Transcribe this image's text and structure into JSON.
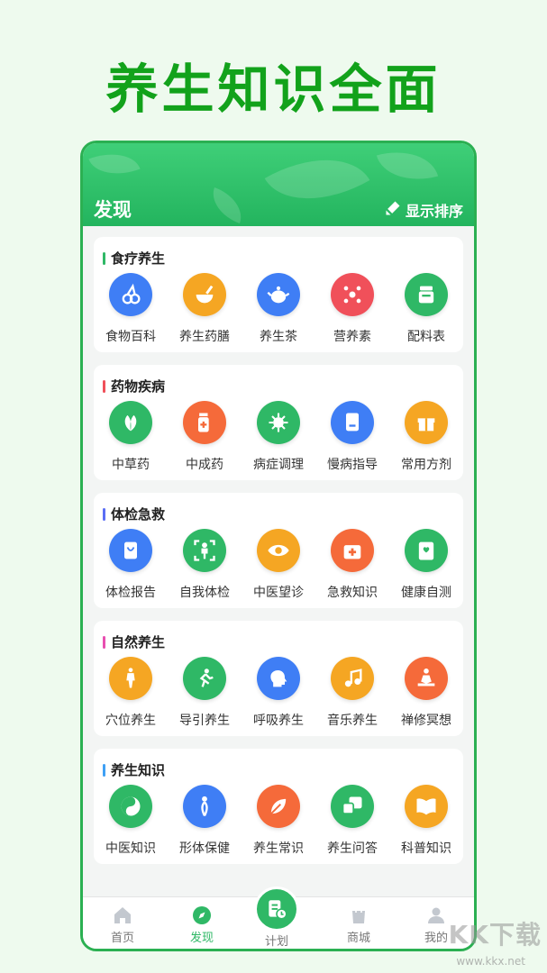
{
  "promo": {
    "headline": "养生知识全面"
  },
  "appbar": {
    "title": "发现",
    "sort_label": "显示排序"
  },
  "sections": [
    {
      "title": "食疗养生",
      "accent": "#2fb866",
      "items": [
        {
          "label": "食物百科",
          "icon": "cherry-icon",
          "color": "#3f7ef5"
        },
        {
          "label": "养生药膳",
          "icon": "mortar-icon",
          "color": "#f5a623"
        },
        {
          "label": "养生茶",
          "icon": "teapot-icon",
          "color": "#3f7ef5"
        },
        {
          "label": "营养素",
          "icon": "nutrient-icon",
          "color": "#f0505a"
        },
        {
          "label": "配料表",
          "icon": "jar-icon",
          "color": "#2fb866"
        }
      ]
    },
    {
      "title": "药物疾病",
      "accent": "#f0505a",
      "items": [
        {
          "label": "中草药",
          "icon": "herb-leaf-icon",
          "color": "#2fb866"
        },
        {
          "label": "中成药",
          "icon": "medicine-bottle-icon",
          "color": "#f56a3a"
        },
        {
          "label": "病症调理",
          "icon": "virus-icon",
          "color": "#2fb866"
        },
        {
          "label": "慢病指导",
          "icon": "book-icon",
          "color": "#3f7ef5"
        },
        {
          "label": "常用方剂",
          "icon": "gift-box-icon",
          "color": "#f5a623"
        }
      ]
    },
    {
      "title": "体检急救",
      "accent": "#5b6ef5",
      "items": [
        {
          "label": "体检报告",
          "icon": "report-icon",
          "color": "#3f7ef5"
        },
        {
          "label": "自我体检",
          "icon": "body-scan-icon",
          "color": "#2fb866"
        },
        {
          "label": "中医望诊",
          "icon": "eye-icon",
          "color": "#f5a623"
        },
        {
          "label": "急救知识",
          "icon": "first-aid-icon",
          "color": "#f56a3a"
        },
        {
          "label": "健康自测",
          "icon": "heart-note-icon",
          "color": "#2fb866"
        }
      ]
    },
    {
      "title": "自然养生",
      "accent": "#e84fb0",
      "items": [
        {
          "label": "穴位养生",
          "icon": "acupoint-body-icon",
          "color": "#f5a623"
        },
        {
          "label": "导引养生",
          "icon": "exercise-icon",
          "color": "#2fb866"
        },
        {
          "label": "呼吸养生",
          "icon": "breathing-head-icon",
          "color": "#3f7ef5"
        },
        {
          "label": "音乐养生",
          "icon": "music-icon",
          "color": "#f5a623"
        },
        {
          "label": "禅修冥想",
          "icon": "meditation-icon",
          "color": "#f56a3a"
        }
      ]
    },
    {
      "title": "养生知识",
      "accent": "#3fa0f5",
      "items": [
        {
          "label": "中医知识",
          "icon": "yin-yang-icon",
          "color": "#2fb866"
        },
        {
          "label": "形体保健",
          "icon": "body-care-icon",
          "color": "#3f7ef5"
        },
        {
          "label": "养生常识",
          "icon": "leaf-tip-icon",
          "color": "#f56a3a"
        },
        {
          "label": "养生问答",
          "icon": "qa-icon",
          "color": "#2fb866"
        },
        {
          "label": "科普知识",
          "icon": "open-book-icon",
          "color": "#f5a623"
        }
      ]
    }
  ],
  "nav": {
    "home": "首页",
    "discover": "发现",
    "plan": "计划",
    "mall": "商城",
    "mine": "我的"
  },
  "watermark": {
    "text": "KK下载",
    "url": "www.kkx.net"
  }
}
